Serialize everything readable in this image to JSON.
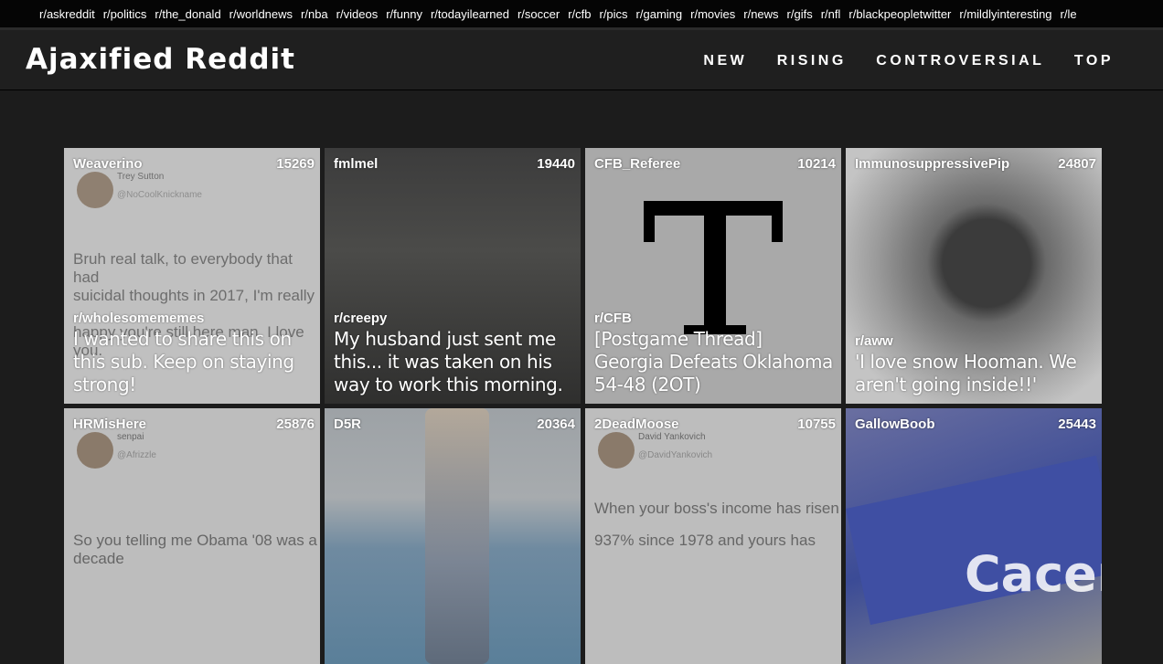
{
  "topbar": {
    "links": [
      "r/askreddit",
      "r/politics",
      "r/the_donald",
      "r/worldnews",
      "r/nba",
      "r/videos",
      "r/funny",
      "r/todayilearned",
      "r/soccer",
      "r/cfb",
      "r/pics",
      "r/gaming",
      "r/movies",
      "r/news",
      "r/gifs",
      "r/nfl",
      "r/blackpeopletwitter",
      "r/mildlyinteresting",
      "r/le"
    ]
  },
  "header": {
    "brand": "Ajaxified Reddit",
    "nav": [
      "NEW",
      "RISING",
      "CONTROVERSIAL",
      "TOP"
    ]
  },
  "posts": [
    {
      "author": "Weaverino",
      "score": "15269",
      "subreddit": "r/wholesomememes",
      "title": "I wanted to share this on this sub. Keep on staying strong!",
      "thumb": "tweet",
      "thumb_text": [
        "Trey Sutton",
        "@NoCoolKnickname",
        "Bruh real talk, to everybody that had",
        "suicidal thoughts in 2017, I'm really",
        "happy you're still here man. I love you."
      ]
    },
    {
      "author": "fmlmel",
      "score": "19440",
      "subreddit": "r/creepy",
      "title": "My husband just sent me this... it was taken on his way to work this morning.",
      "thumb": "dark"
    },
    {
      "author": "CFB_Referee",
      "score": "10214",
      "subreddit": "r/CFB",
      "title": "[Postgame Thread] Georgia Defeats Oklahoma 54-48 (2OT)",
      "thumb": "cfb"
    },
    {
      "author": "ImmunosuppressivePip",
      "score": "24807",
      "subreddit": "r/aww",
      "title": "'I love snow Hooman. We aren't going inside!!'",
      "thumb": "dog"
    },
    {
      "author": "HRMisHere",
      "score": "25876",
      "subreddit": "",
      "title": "",
      "thumb": "tweet",
      "thumb_text": [
        "senpai",
        "@Afrizzle",
        "So you telling me Obama '08 was a decade"
      ]
    },
    {
      "author": "D5R",
      "score": "20364",
      "subreddit": "",
      "title": "",
      "thumb": "pool"
    },
    {
      "author": "2DeadMoose",
      "score": "10755",
      "subreddit": "",
      "title": "",
      "thumb": "tweet",
      "thumb_text": [
        "David Yankovich",
        "@DavidYankovich",
        "When your boss's income has risen",
        "937% since 1978 and yours has"
      ]
    },
    {
      "author": "GallowBoob",
      "score": "25443",
      "subreddit": "",
      "title": "",
      "thumb": "stadium",
      "thumb_text": [
        "Cacem"
      ]
    }
  ],
  "colors": {
    "background": "#1c1c1c",
    "header": "#1f1f1f",
    "topbar": "#050505"
  }
}
